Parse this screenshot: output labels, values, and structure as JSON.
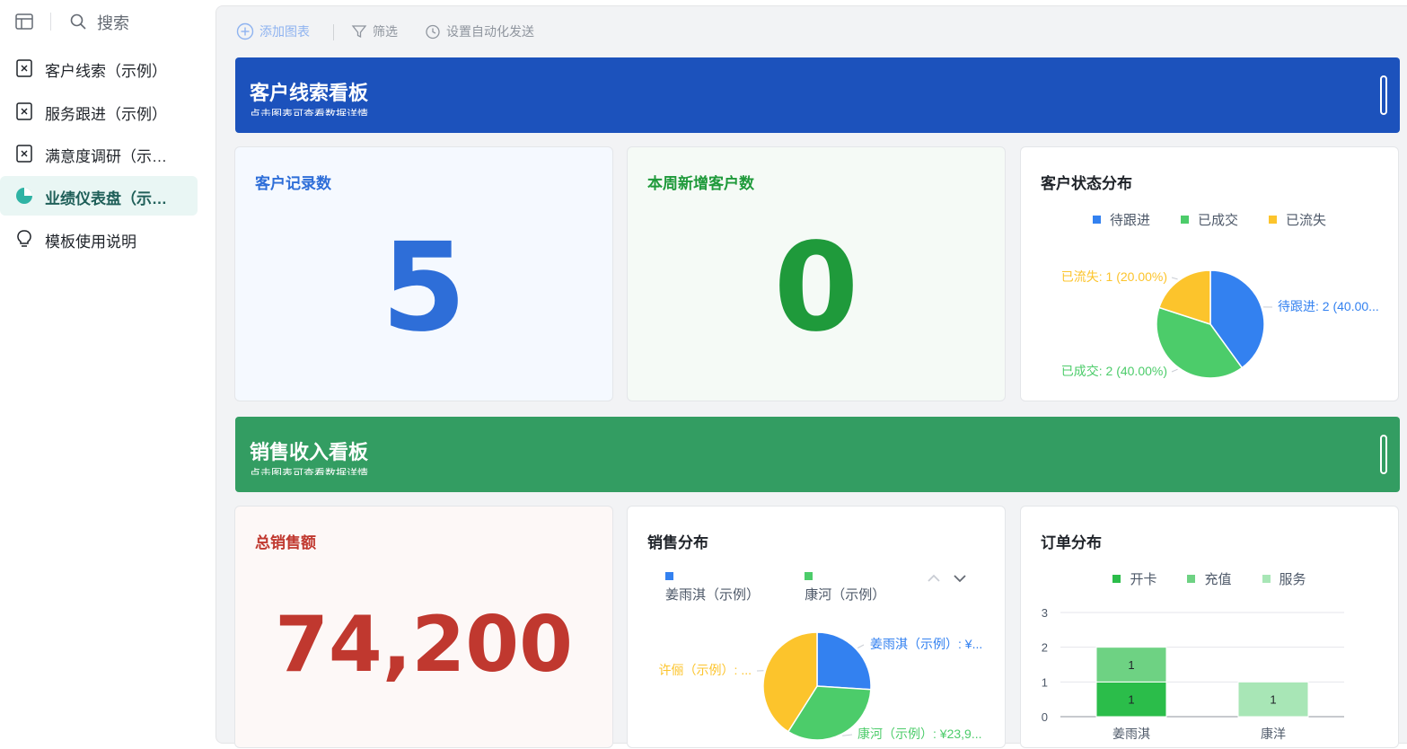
{
  "sidebar": {
    "search_label": "搜索",
    "items": [
      {
        "label": "客户线索（示例）",
        "icon": "table-icon"
      },
      {
        "label": "服务跟进（示例）",
        "icon": "table-icon"
      },
      {
        "label": "满意度调研（示例）",
        "icon": "table-icon"
      },
      {
        "label": "业绩仪表盘（示例）",
        "icon": "dashboard-icon",
        "active": true
      },
      {
        "label": "模板使用说明",
        "icon": "lightbulb-icon"
      }
    ]
  },
  "toolbar": {
    "add_chart": "添加图表",
    "filter": "筛选",
    "auto_send": "设置自动化发送"
  },
  "sections": {
    "leads": {
      "title": "客户线索看板",
      "subtitle": "点击图表可查看数据详情"
    },
    "sales": {
      "title": "销售收入看板",
      "subtitle": "点击图表可查看数据详情"
    }
  },
  "cards": {
    "record_count": {
      "title": "客户记录数",
      "value": "5",
      "color": "#2e6ed8"
    },
    "new_this_week": {
      "title": "本周新增客户数",
      "value": "0",
      "color": "#1f9a3b"
    },
    "status_dist": {
      "title": "客户状态分布"
    },
    "total_sales": {
      "title": "总销售额",
      "value": "74,200",
      "color": "#c0382f"
    },
    "sales_dist": {
      "title": "销售分布"
    },
    "order_dist": {
      "title": "订单分布"
    }
  },
  "chart_data": [
    {
      "type": "pie",
      "title": "客户状态分布",
      "legend": "top-center",
      "categories": [
        "待跟进",
        "已成交",
        "已流失"
      ],
      "values": [
        2,
        2,
        1
      ],
      "colors": [
        "#3381f0",
        "#4ccc6a",
        "#fcc42c"
      ],
      "labels": [
        "待跟进: 2 (40.00...",
        "已成交: 2 (40.00%)",
        "已流失: 1 (20.00%)"
      ]
    },
    {
      "type": "pie",
      "title": "销售分布",
      "legend": "top-center",
      "categories": [
        "姜雨淇（示例）",
        "康河（示例）",
        "许俪（示例）"
      ],
      "values": [
        0.26,
        0.33,
        0.41
      ],
      "colors": [
        "#3381f0",
        "#4ccc6a",
        "#fcc42c"
      ],
      "labels": [
        "姜雨淇（示例）: ¥...",
        "康河（示例）: ¥23,9...",
        "许俪（示例）: ..."
      ]
    },
    {
      "type": "bar",
      "title": "订单分布",
      "stacked": true,
      "legend": "top-center",
      "categories": [
        "姜雨淇",
        "康洋"
      ],
      "series": [
        {
          "name": "开卡",
          "values": [
            1,
            0
          ],
          "color": "#2bbd4a"
        },
        {
          "name": "充值",
          "values": [
            1,
            0
          ],
          "color": "#6ed283"
        },
        {
          "name": "服务",
          "values": [
            0,
            1
          ],
          "color": "#a8e6b6"
        }
      ],
      "ylim": [
        0,
        3
      ],
      "yticks": [
        "0",
        "1",
        "2",
        "3"
      ],
      "grid": true
    }
  ]
}
